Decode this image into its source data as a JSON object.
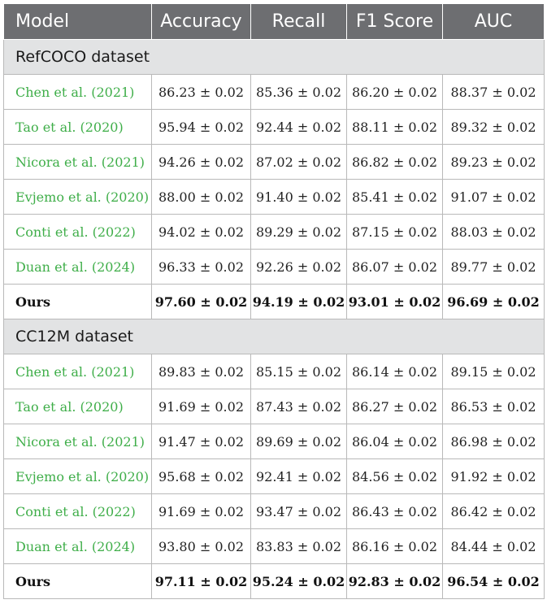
{
  "columns": [
    "Model",
    "Accuracy",
    "Recall",
    "F1 Score",
    "AUC"
  ],
  "sections": [
    {
      "title": "RefCOCO dataset",
      "rows": [
        {
          "model": "Chen et al. (2021)",
          "values": [
            "86.23 ± 0.02",
            "85.36 ± 0.02",
            "86.20 ± 0.02",
            "88.37 ± 0.02"
          ]
        },
        {
          "model": "Tao et al. (2020)",
          "values": [
            "95.94 ± 0.02",
            "92.44 ± 0.02",
            "88.11 ± 0.02",
            "89.32 ± 0.02"
          ]
        },
        {
          "model": "Nicora et al. (2021)",
          "values": [
            "94.26 ± 0.02",
            "87.02 ± 0.02",
            "86.82 ± 0.02",
            "89.23 ± 0.02"
          ]
        },
        {
          "model": "Evjemo et al. (2020)",
          "values": [
            "88.00 ± 0.02",
            "91.40 ± 0.02",
            "85.41 ± 0.02",
            "91.07 ± 0.02"
          ]
        },
        {
          "model": "Conti et al. (2022)",
          "values": [
            "94.02 ± 0.02",
            "89.29 ± 0.02",
            "87.15 ± 0.02",
            "88.03 ± 0.02"
          ]
        },
        {
          "model": "Duan et al. (2024)",
          "values": [
            "96.33 ± 0.02",
            "92.26 ± 0.02",
            "86.07 ± 0.02",
            "89.77 ± 0.02"
          ]
        },
        {
          "model": "Ours",
          "values": [
            "97.60 ± 0.02",
            "94.19 ± 0.02",
            "93.01 ± 0.02",
            "96.69 ± 0.02"
          ]
        }
      ]
    },
    {
      "title": "CC12M dataset",
      "rows": [
        {
          "model": "Chen et al. (2021)",
          "values": [
            "89.83 ± 0.02",
            "85.15 ± 0.02",
            "86.14 ± 0.02",
            "89.15 ± 0.02"
          ]
        },
        {
          "model": "Tao et al. (2020)",
          "values": [
            "91.69 ± 0.02",
            "87.43 ± 0.02",
            "86.27 ± 0.02",
            "86.53 ± 0.02"
          ]
        },
        {
          "model": "Nicora et al. (2021)",
          "values": [
            "91.47 ± 0.02",
            "89.69 ± 0.02",
            "86.04 ± 0.02",
            "86.98 ± 0.02"
          ]
        },
        {
          "model": "Evjemo et al. (2020)",
          "values": [
            "95.68 ± 0.02",
            "92.41 ± 0.02",
            "84.56 ± 0.02",
            "91.92 ± 0.02"
          ]
        },
        {
          "model": "Conti et al. (2022)",
          "values": [
            "91.69 ± 0.02",
            "93.47 ± 0.02",
            "86.43 ± 0.02",
            "86.42 ± 0.02"
          ]
        },
        {
          "model": "Duan et al. (2024)",
          "values": [
            "93.80 ± 0.02",
            "83.83 ± 0.02",
            "86.16 ± 0.02",
            "84.44 ± 0.02"
          ]
        },
        {
          "model": "Ours",
          "values": [
            "97.11 ± 0.02",
            "95.24 ± 0.02",
            "92.83 ± 0.02",
            "96.54 ± 0.02"
          ]
        }
      ]
    }
  ],
  "colors": {
    "header_bg": "#6d6e71",
    "section_bg": "#e2e3e4",
    "citation_link": "#3fae49",
    "border": "#b9b9b9"
  }
}
